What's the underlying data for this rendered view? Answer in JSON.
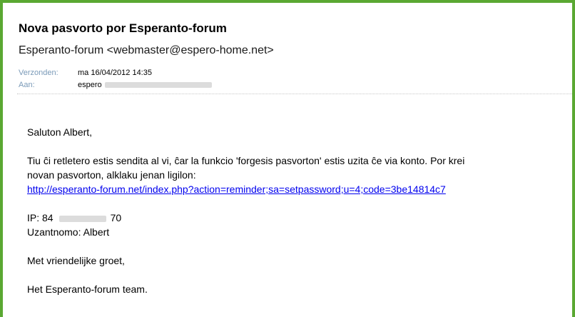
{
  "email": {
    "subject": "Nova pasvorto por Esperanto-forum",
    "sender": "Esperanto-forum <webmaster@espero-home.net>",
    "sent_label": "Verzonden:",
    "sent_value": "ma 16/04/2012 14:35",
    "to_label": "Aan:",
    "to_value": "espero"
  },
  "body": {
    "greeting": "Saluton Albert,",
    "paragraph_line1": "Tiu ĉi retletero estis sendita al vi, ĉar la funkcio 'forgesis pasvorton' estis uzita ĉe via konto. Por krei",
    "paragraph_line2": "novan pasvorton, alklaku jenan ligilon:",
    "link": "http://esperanto-forum.net/index.php?action=reminder;sa=setpassword;u=4;code=3be14814c7",
    "ip_prefix": "IP: 84",
    "ip_suffix": "70",
    "username": "Uzantnomo: Albert",
    "closing": "Met vriendelijke groet,",
    "signature": "Het Esperanto-forum team."
  },
  "colors": {
    "frame_border": "#5aa832",
    "meta_label": "#7a9ab8",
    "link": "#0000ee"
  }
}
